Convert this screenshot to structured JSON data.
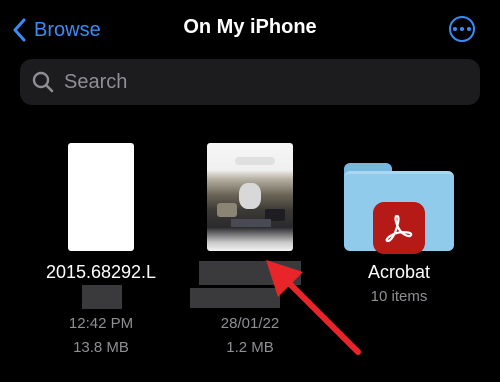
{
  "nav": {
    "back_label": "Browse",
    "title": "On My iPhone",
    "more_icon": "ellipsis-circle-icon"
  },
  "search": {
    "placeholder": "Search"
  },
  "files": [
    {
      "name": "2015.68292.L",
      "time": "12:42 PM",
      "size": "13.8 MB",
      "icon": "document-thumbnail"
    },
    {
      "name": "",
      "date": "28/01/22",
      "size": "1.2 MB",
      "icon": "photo-thumbnail"
    },
    {
      "name": "Acrobat",
      "count": "10 items",
      "icon": "adobe-acrobat-folder-icon"
    }
  ],
  "colors": {
    "accent": "#3b8bf6",
    "background": "#000000",
    "secondary_text": "#8e8e93",
    "annotation_arrow": "#e8262a",
    "folder": "#90cbec",
    "acrobat_red": "#b51a17"
  }
}
